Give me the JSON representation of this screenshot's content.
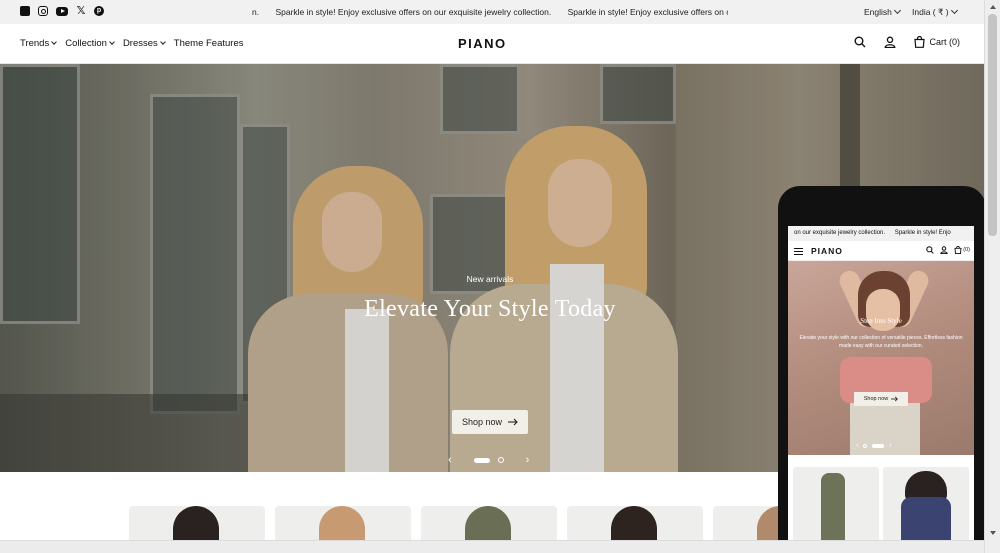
{
  "announcement": {
    "socials": [
      "facebook-icon",
      "instagram-icon",
      "youtube-icon",
      "x-icon",
      "pinterest-icon"
    ],
    "marquee": [
      "n.",
      "Sparkle in style! Enjoy exclusive offers on our exquisite jewelry collection.",
      "Sparkle in style! Enjoy exclusive offers on our e"
    ],
    "language": "English",
    "country": "India ( ₹ )"
  },
  "header": {
    "nav": [
      {
        "label": "Trends",
        "dropdown": true
      },
      {
        "label": "Collection",
        "dropdown": true
      },
      {
        "label": "Dresses",
        "dropdown": true
      },
      {
        "label": "Theme Features",
        "dropdown": false
      }
    ],
    "logo": "PIANO",
    "cart_label": "Cart (0)"
  },
  "hero": {
    "eyebrow": "New arrivals",
    "title": "Elevate Your Style Today",
    "button_label": "Shop now",
    "slides": 2,
    "active_slide": 1
  },
  "mobile": {
    "announcement": [
      "on our exquisite jewelry collection.",
      "Sparkle in style! Enjo"
    ],
    "logo": "PIANO",
    "cart_count": "(0)",
    "hero_title": "Step Into Style",
    "hero_desc": "Elevate your style with our collection of versatile pieces. Effortless fashion made easy with our curated selection.",
    "button_label": "Shop now"
  },
  "colors": {
    "announcement_bg": "#f1f1f1",
    "button_bg": "#f2efe9",
    "text": "#111111"
  }
}
